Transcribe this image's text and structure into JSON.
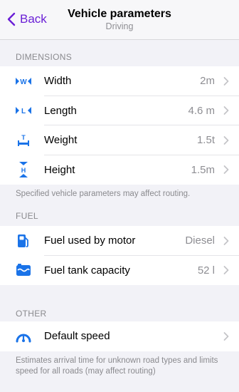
{
  "navbar": {
    "back_label": "Back",
    "title": "Vehicle parameters",
    "subtitle": "Driving"
  },
  "colors": {
    "accent": "#6a1fd6",
    "icon_blue": "#1a73e8",
    "background": "#f2f2f7",
    "secondary_text": "#8e8e93"
  },
  "dimensions": {
    "header": "DIMENSIONS",
    "rows": [
      {
        "icon": "width-icon",
        "label": "Width",
        "value": "2m"
      },
      {
        "icon": "length-icon",
        "label": "Length",
        "value": "4.6 m"
      },
      {
        "icon": "weight-icon",
        "label": "Weight",
        "value": "1.5t"
      },
      {
        "icon": "height-icon",
        "label": "Height",
        "value": "1.5m"
      }
    ],
    "footnote": "Specified vehicle parameters may affect routing."
  },
  "fuel": {
    "header": "FUEL",
    "rows": [
      {
        "icon": "fuel-pump-icon",
        "label": "Fuel used by motor",
        "value": "Diesel"
      },
      {
        "icon": "fuel-tank-icon",
        "label": "Fuel tank capacity",
        "value": "52 l"
      }
    ]
  },
  "other": {
    "header": "OTHER",
    "rows": [
      {
        "icon": "speedometer-icon",
        "label": "Default speed",
        "value": ""
      }
    ],
    "footnote": "Estimates arrival time for unknown road types and limits speed for all roads (may affect routing)"
  }
}
